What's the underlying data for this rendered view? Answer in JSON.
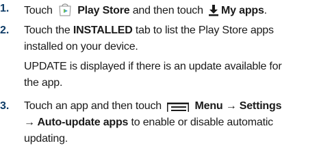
{
  "steps": [
    {
      "number": "1.",
      "lines": [
        {
          "a": "Touch",
          "b": "Play Store",
          "c": "and then touch",
          "d": "My apps",
          "e": "."
        }
      ]
    },
    {
      "number": "2.",
      "lines": [
        {
          "a": "Touch the",
          "b": "INSTALLED",
          "c": "tab to list the Play Store apps"
        },
        {
          "a": "installed on your device."
        },
        {
          "a": "UPDATE is displayed if there is an update available for"
        },
        {
          "a": "the app."
        }
      ]
    },
    {
      "number": "3.",
      "lines": [
        {
          "a": "Touch an app and then touch",
          "b": "Menu → Settings"
        },
        {
          "b": "→ Auto-update apps",
          "c": "to enable or disable automatic"
        },
        {
          "a": "updating."
        }
      ]
    }
  ],
  "icons": {
    "play_store": "play-store-icon",
    "download": "download-icon",
    "menu": "menu-icon"
  },
  "colors": {
    "step_number": "#0d3b66",
    "text": "#1a1a1a"
  }
}
